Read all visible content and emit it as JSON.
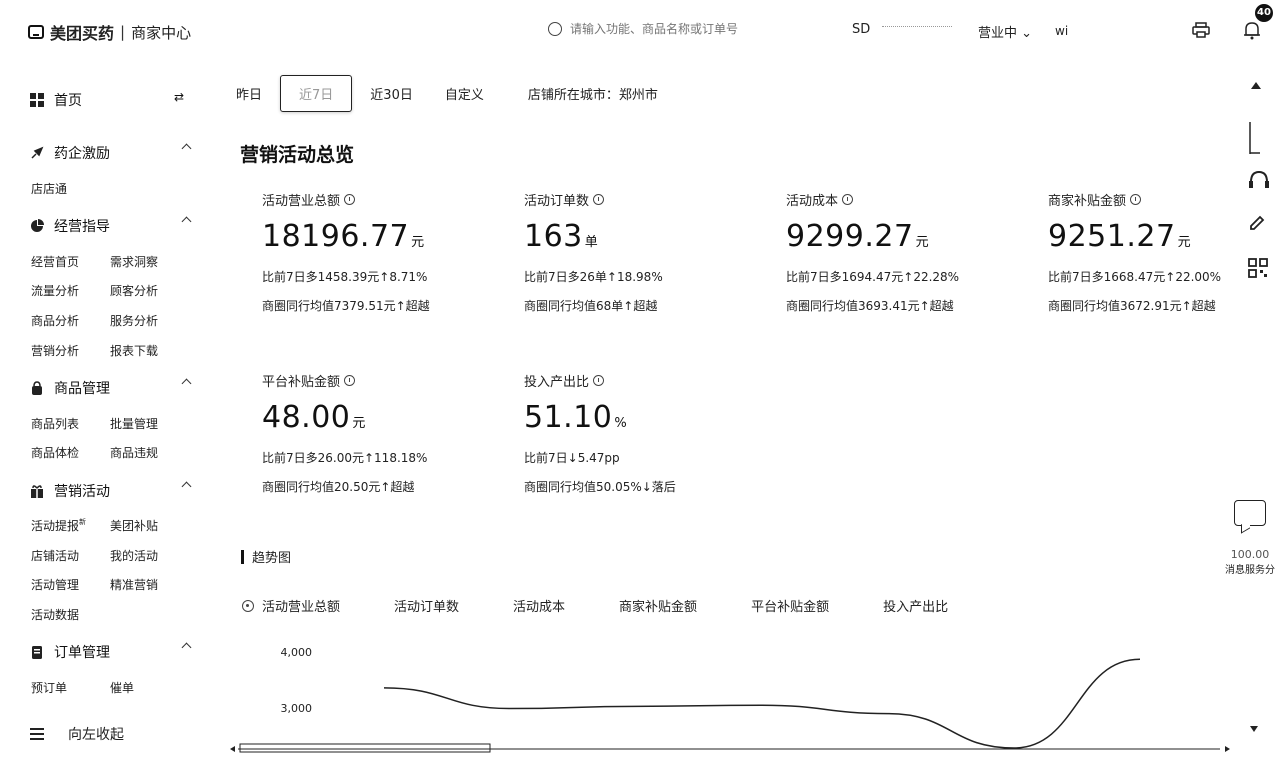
{
  "header": {
    "brand": "美团买药",
    "section": "商家中心",
    "search_placeholder": "请输入功能、商品名称或订单号",
    "store_id": "SD",
    "status": "营业中",
    "user": "wi",
    "notification_count": "40"
  },
  "sidebar": {
    "home": "首页",
    "groups": [
      {
        "label": "药企激励",
        "items": [
          "店店通"
        ]
      },
      {
        "label": "经营指导",
        "items": [
          "经营首页",
          "需求洞察",
          "流量分析",
          "顾客分析",
          "商品分析",
          "服务分析",
          "营销分析",
          "报表下载"
        ]
      },
      {
        "label": "商品管理",
        "items": [
          "商品列表",
          "批量管理",
          "商品体检",
          "商品违规"
        ]
      },
      {
        "label": "营销活动",
        "items": [
          "活动提报",
          "美团补贴",
          "店铺活动",
          "我的活动",
          "活动管理",
          "精准营销",
          "活动数据"
        ]
      },
      {
        "label": "订单管理",
        "items": [
          "预订单",
          "催单"
        ]
      }
    ],
    "collapse": "向左收起"
  },
  "filters": {
    "tabs": [
      "昨日",
      "近7日",
      "近30日",
      "自定义"
    ],
    "active_tab": "近7日",
    "city_label": "店铺所在城市：",
    "city": "郑州市"
  },
  "overview": {
    "title": "营销活动总览",
    "metrics": [
      {
        "label": "活动营业总额",
        "value": "18196.77",
        "unit": "元",
        "compare": "比前7日多1458.39元↑8.71%",
        "benchmark": "商圈同行均值7379.51元↑超越"
      },
      {
        "label": "活动订单数",
        "value": "163",
        "unit": "单",
        "compare": "比前7日多26单↑18.98%",
        "benchmark": "商圈同行均值68单↑超越"
      },
      {
        "label": "活动成本",
        "value": "9299.27",
        "unit": "元",
        "compare": "比前7日多1694.47元↑22.28%",
        "benchmark": "商圈同行均值3693.41元↑超越"
      },
      {
        "label": "商家补贴金额",
        "value": "9251.27",
        "unit": "元",
        "compare": "比前7日多1668.47元↑22.00%",
        "benchmark": "商圈同行均值3672.91元↑超越"
      },
      {
        "label": "平台补贴金额",
        "value": "48.00",
        "unit": "元",
        "compare": "比前7日多26.00元↑118.18%",
        "benchmark": "商圈同行均值20.50元↑超越"
      },
      {
        "label": "投入产出比",
        "value": "51.10",
        "unit": "%",
        "compare": "比前7日↓5.47pp",
        "benchmark": "商圈同行均值50.05%↓落后"
      }
    ]
  },
  "trend": {
    "title": "趋势图",
    "tabs": [
      "活动营业总额",
      "活动订单数",
      "活动成本",
      "商家补贴金额",
      "平台补贴金额",
      "投入产出比"
    ],
    "y_ticks": [
      "4,000",
      "3,000"
    ]
  },
  "chart_data": {
    "type": "line",
    "series": [
      {
        "values": [
          3360,
          2990,
          3030,
          3050,
          2900,
          1900,
          3870
        ]
      }
    ],
    "y_ticks": [
      "4,000",
      "3,000"
    ]
  },
  "feedback": {
    "score": "100.00",
    "label": "消息服务分"
  }
}
